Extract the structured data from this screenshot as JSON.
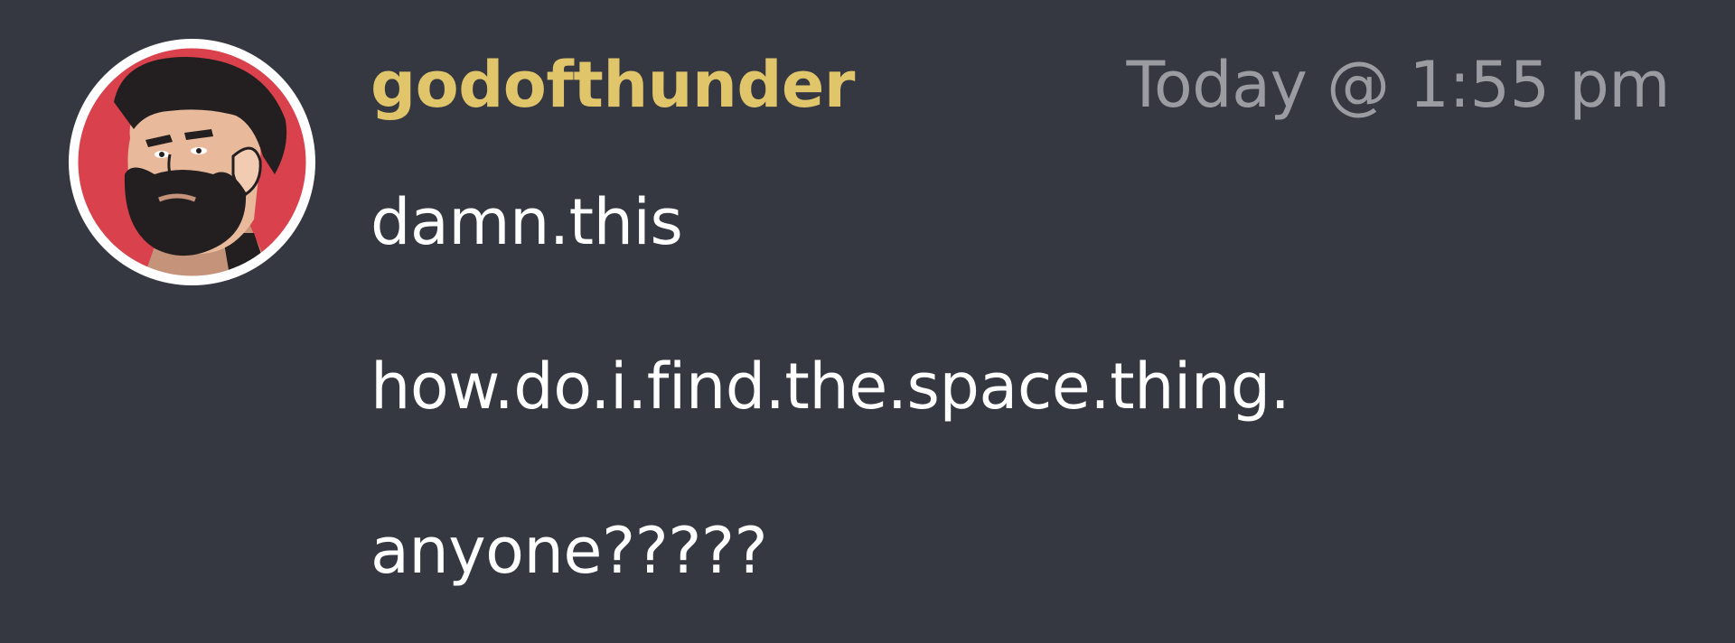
{
  "message": {
    "username": "godofthunder",
    "timestamp": "Today @ 1:55 pm",
    "lines": [
      "damn.this",
      "how.do.i.find.the.space.thing.",
      "anyone?????"
    ]
  },
  "avatar": {
    "icon": "bearded-man-avatar",
    "ring_color": "#ffffff",
    "background_color": "#d9414c"
  },
  "colors": {
    "page_background": "#363841",
    "username": "#e0c56a",
    "timestamp": "#9a9ca2",
    "message_text": "#ffffff"
  }
}
